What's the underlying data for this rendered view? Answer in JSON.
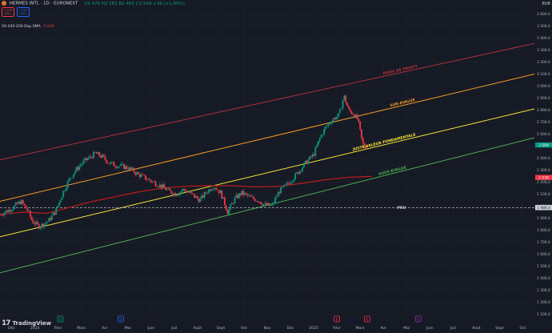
{
  "header": {
    "symbol": "HERMES INTL · 1D · EURONEXT",
    "ohlc": "O2 476 H2 581 B2 465 C2 509 +39 (+1,65%)"
  },
  "trade": {
    "sell_price": "2 509",
    "sell_label": "SELL",
    "buy_price": "2 509",
    "buy_label": "BUY"
  },
  "indicator": {
    "label": "50-100-200 Day SMA",
    "value": "2 239"
  },
  "currency": "EUR",
  "branding": {
    "mark": "17",
    "name": "TradingView"
  },
  "colors": {
    "bg": "#161a25",
    "up": "#089981",
    "down": "#f23645",
    "sma": "#b71c1c",
    "prise_profit": "#b2303c",
    "sur_evalue": "#f59a23",
    "juste_valeur": "#f5e53a",
    "sous_evalue": "#4caf50",
    "pru": "#d1d4dc"
  },
  "chart_data": {
    "type": "candlestick",
    "ylim": [
      1050,
      3650
    ],
    "y_ticks": [
      1100,
      1200,
      1300,
      1400,
      1500,
      1600,
      1700,
      1800,
      1900,
      2000,
      2100,
      2200,
      2300,
      2400,
      2500,
      2600,
      2700,
      2800,
      2900,
      3000,
      3100,
      3200,
      3300,
      3400,
      3500,
      3600
    ],
    "y_tick_labels": [
      "1 100,0",
      "1 200,0",
      "1 300,0",
      "1 400,0",
      "1 500,0",
      "1 600,0",
      "1 700,0",
      "1 800,0",
      "1 900,0",
      "2 000,0",
      "2 100,0",
      "2 200,0",
      "2 300,0",
      "2 400,0",
      "2 500,0",
      "2 600,0",
      "2 700,0",
      "2 800,0",
      "2 900,0",
      "3 000,0",
      "3 100,0",
      "3 200,0",
      "3 300,0",
      "3 400,0",
      "3 500,0",
      "3 600,0"
    ],
    "x_axis": [
      {
        "label": "Déc",
        "x": 0.5
      },
      {
        "label": "2024",
        "x": 1.5
      },
      {
        "label": "Févr",
        "x": 2.5
      },
      {
        "label": "Mars",
        "x": 3.5
      },
      {
        "label": "Avr",
        "x": 4.5
      },
      {
        "label": "Mai",
        "x": 5.5
      },
      {
        "label": "Juin",
        "x": 6.5
      },
      {
        "label": "Juil",
        "x": 7.5
      },
      {
        "label": "Août",
        "x": 8.5
      },
      {
        "label": "Sept",
        "x": 9.5
      },
      {
        "label": "Oct",
        "x": 10.5
      },
      {
        "label": "Nov",
        "x": 11.5
      },
      {
        "label": "Déc",
        "x": 12.5
      },
      {
        "label": "2025",
        "x": 13.5
      },
      {
        "label": "Févr",
        "x": 14.5
      },
      {
        "label": "Mars",
        "x": 15.5
      },
      {
        "label": "Avr",
        "x": 16.5
      },
      {
        "label": "Mai",
        "x": 17.5
      },
      {
        "label": "Juin",
        "x": 18.5
      },
      {
        "label": "Juil",
        "x": 19.5
      },
      {
        "label": "Août",
        "x": 20.5
      },
      {
        "label": "Sept",
        "x": 21.5
      },
      {
        "label": "Oct",
        "x": 22.5
      }
    ],
    "xlim": [
      0,
      23
    ],
    "close_path": [
      [
        0.0,
        1930
      ],
      [
        0.5,
        1980
      ],
      [
        0.9,
        2040
      ],
      [
        1.2,
        1960
      ],
      [
        1.4,
        1870
      ],
      [
        1.7,
        1830
      ],
      [
        2.1,
        1880
      ],
      [
        2.4,
        1960
      ],
      [
        2.7,
        2110
      ],
      [
        3.0,
        2230
      ],
      [
        3.3,
        2310
      ],
      [
        3.6,
        2370
      ],
      [
        3.9,
        2410
      ],
      [
        4.1,
        2440
      ],
      [
        4.4,
        2410
      ],
      [
        4.7,
        2360
      ],
      [
        5.0,
        2340
      ],
      [
        5.3,
        2330
      ],
      [
        5.6,
        2310
      ],
      [
        5.9,
        2270
      ],
      [
        6.3,
        2230
      ],
      [
        6.6,
        2200
      ],
      [
        7.0,
        2160
      ],
      [
        7.3,
        2120
      ],
      [
        7.6,
        2100
      ],
      [
        7.9,
        2140
      ],
      [
        8.3,
        2090
      ],
      [
        8.6,
        2050
      ],
      [
        8.9,
        2120
      ],
      [
        9.2,
        2170
      ],
      [
        9.5,
        2110
      ],
      [
        9.8,
        1950
      ],
      [
        10.1,
        2060
      ],
      [
        10.4,
        2110
      ],
      [
        10.8,
        2070
      ],
      [
        11.1,
        2050
      ],
      [
        11.4,
        2010
      ],
      [
        11.7,
        2000
      ],
      [
        12.0,
        2120
      ],
      [
        12.3,
        2170
      ],
      [
        12.6,
        2230
      ],
      [
        12.9,
        2300
      ],
      [
        13.2,
        2370
      ],
      [
        13.5,
        2430
      ],
      [
        13.8,
        2580
      ],
      [
        14.0,
        2650
      ],
      [
        14.3,
        2720
      ],
      [
        14.6,
        2760
      ],
      [
        14.8,
        2920
      ],
      [
        15.0,
        2800
      ],
      [
        15.2,
        2770
      ],
      [
        15.4,
        2720
      ],
      [
        15.6,
        2520
      ],
      [
        15.8,
        2485
      ]
    ],
    "sma_path": [
      [
        0,
        1930
      ],
      [
        1.0,
        1950
      ],
      [
        2.0,
        1940
      ],
      [
        3.0,
        1990
      ],
      [
        4.0,
        2040
      ],
      [
        5.0,
        2080
      ],
      [
        6.0,
        2120
      ],
      [
        7.0,
        2150
      ],
      [
        8.0,
        2165
      ],
      [
        9.0,
        2170
      ],
      [
        10.0,
        2170
      ],
      [
        11.0,
        2160
      ],
      [
        12.0,
        2165
      ],
      [
        13.0,
        2190
      ],
      [
        14.0,
        2220
      ],
      [
        15.0,
        2240
      ],
      [
        16.0,
        2248
      ]
    ],
    "channels": [
      {
        "name": "PRISE DE PROFIT",
        "p1": [
          0,
          2385
        ],
        "p2": [
          23,
          3355
        ],
        "color": "#b2303c",
        "label_x": 16.5
      },
      {
        "name": "SUR-EVALUE",
        "p1": [
          0,
          2040
        ],
        "p2": [
          23,
          3100
        ],
        "color": "#f59a23",
        "label_x": 16.8
      },
      {
        "name": "JUSTE-VALEUR FONDAMENTALE",
        "p1": [
          0,
          1745
        ],
        "p2": [
          23,
          2810
        ],
        "color": "#f5e53a",
        "label_x": 15.2
      },
      {
        "name": "SOUS-EVALUE",
        "p1": [
          0,
          1445
        ],
        "p2": [
          23,
          2570
        ],
        "color": "#4caf50",
        "label_x": 16.3
      }
    ],
    "pru": {
      "label": "PRU",
      "value": 1988.0,
      "value_label": "1 988,0"
    },
    "price_tags": [
      {
        "value": 2509,
        "label": "2 509",
        "color": "#089981"
      },
      {
        "value": 2239,
        "label": "2 239",
        "color": "#f23645"
      },
      {
        "value": 1988,
        "label": "1 988,0",
        "color": "#d1d4dc"
      }
    ],
    "event_markers": [
      {
        "x": 2.6,
        "glyph": "D",
        "color": "#089981"
      },
      {
        "x": 5.2,
        "glyph": "D",
        "color": "#2962ff"
      },
      {
        "x": 14.5,
        "glyph": "E",
        "color": "#f23645"
      },
      {
        "x": 15.8,
        "glyph": "E",
        "color": "#f23645"
      },
      {
        "x": 18.0,
        "glyph": "E",
        "color": "#9c27b0"
      }
    ]
  }
}
